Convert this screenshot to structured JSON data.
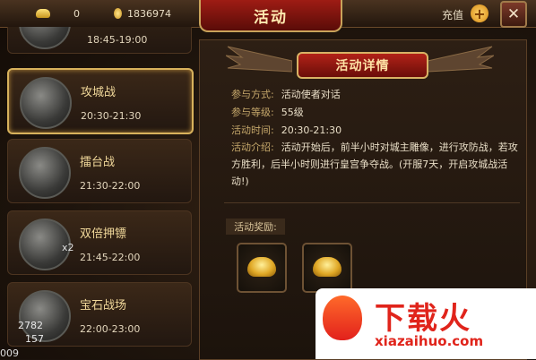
{
  "topbar": {
    "ingot_amount": "0",
    "coin_amount": "1836974",
    "title": "活动",
    "recharge_label": "充值",
    "plus_symbol": "+",
    "close_symbol": "✕"
  },
  "activities": [
    {
      "name": "",
      "badge": "",
      "time": "18:45-19:00",
      "active": false
    },
    {
      "name": "攻城战",
      "badge": "",
      "time": "20:30-21:30",
      "active": true
    },
    {
      "name": "擂台战",
      "badge": "",
      "time": "21:30-22:00",
      "active": false
    },
    {
      "name": "双倍押镖",
      "badge": "x2",
      "time": "21:45-22:00",
      "active": false
    },
    {
      "name": "宝石战场",
      "badge": "",
      "time": "22:00-23:00",
      "active": false
    }
  ],
  "bottom_stats": {
    "line1": "2782",
    "line2": "157",
    "corner": "009"
  },
  "detail": {
    "title": "活动详情",
    "join_label": "参与方式:",
    "join_value": "活动使者对话",
    "level_label": "参与等级:",
    "level_value": "55级",
    "time_label": "活动时间:",
    "time_value": "20:30-21:30",
    "intro_label": "活动介绍:",
    "intro_value": "活动开始后，前半小时对城主雕像，进行攻防战，若攻方胜利，后半小时则进行皇宫争夺战。(开服7天，开启攻城战活动!)",
    "reward_label": "活动奖励:"
  },
  "rewards": [
    {
      "icon": "gold-ingot-icon"
    },
    {
      "icon": "gold-ingot-icon"
    }
  ],
  "watermark": {
    "text": "下载火",
    "url": "xiazaihuo.com"
  }
}
